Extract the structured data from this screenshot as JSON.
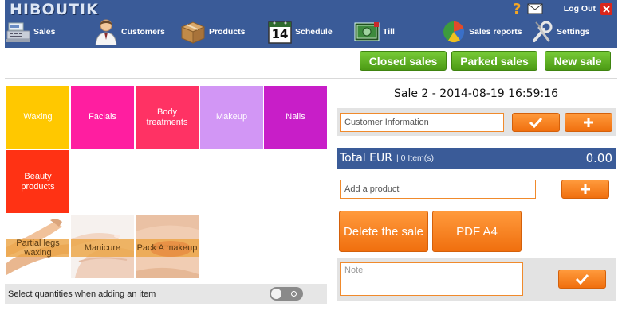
{
  "app": {
    "logo": "HIBOUTIK"
  },
  "nav": {
    "sales": "Sales",
    "customers": "Customers",
    "products": "Products",
    "schedule": "Schedule",
    "schedule_day": "14",
    "till": "Till",
    "sales_reports": "Sales reports",
    "settings": "Settings",
    "logout": "Log Out"
  },
  "actions": {
    "closed_sales": "Closed sales",
    "parked_sales": "Parked sales",
    "new_sale": "New sale"
  },
  "categories": [
    {
      "label": "Waxing",
      "color": "#ffc800"
    },
    {
      "label": "Facials",
      "color": "#ff1ea0"
    },
    {
      "label": "Body treatments",
      "color": "#ff3264"
    },
    {
      "label": "Makeup",
      "color": "#d296f5"
    },
    {
      "label": "Nails",
      "color": "#c81ec8"
    },
    {
      "label": "Beauty products",
      "color": "#ff3214"
    }
  ],
  "products": [
    {
      "label": "Partial legs waxing"
    },
    {
      "label": "Manicure"
    },
    {
      "label": "Pack A makeup"
    }
  ],
  "options": {
    "select_quantities": "Select quantities when adding an item",
    "select_quantities_on": false
  },
  "sale": {
    "title": "Sale 2 - 2014-08-19 16:59:16",
    "customer_placeholder": "Customer Information",
    "total_label": "Total EUR",
    "items_count": "| 0 Item(s)",
    "total_value": "0.00",
    "add_product_placeholder": "Add a product",
    "delete_label": "Delete the sale",
    "pdf_label": "PDF A4",
    "note_placeholder": "Note"
  },
  "colors": {
    "nav_bg": "#3a5b98",
    "action_green": "#5aae20",
    "action_orange": "#f47a18"
  }
}
